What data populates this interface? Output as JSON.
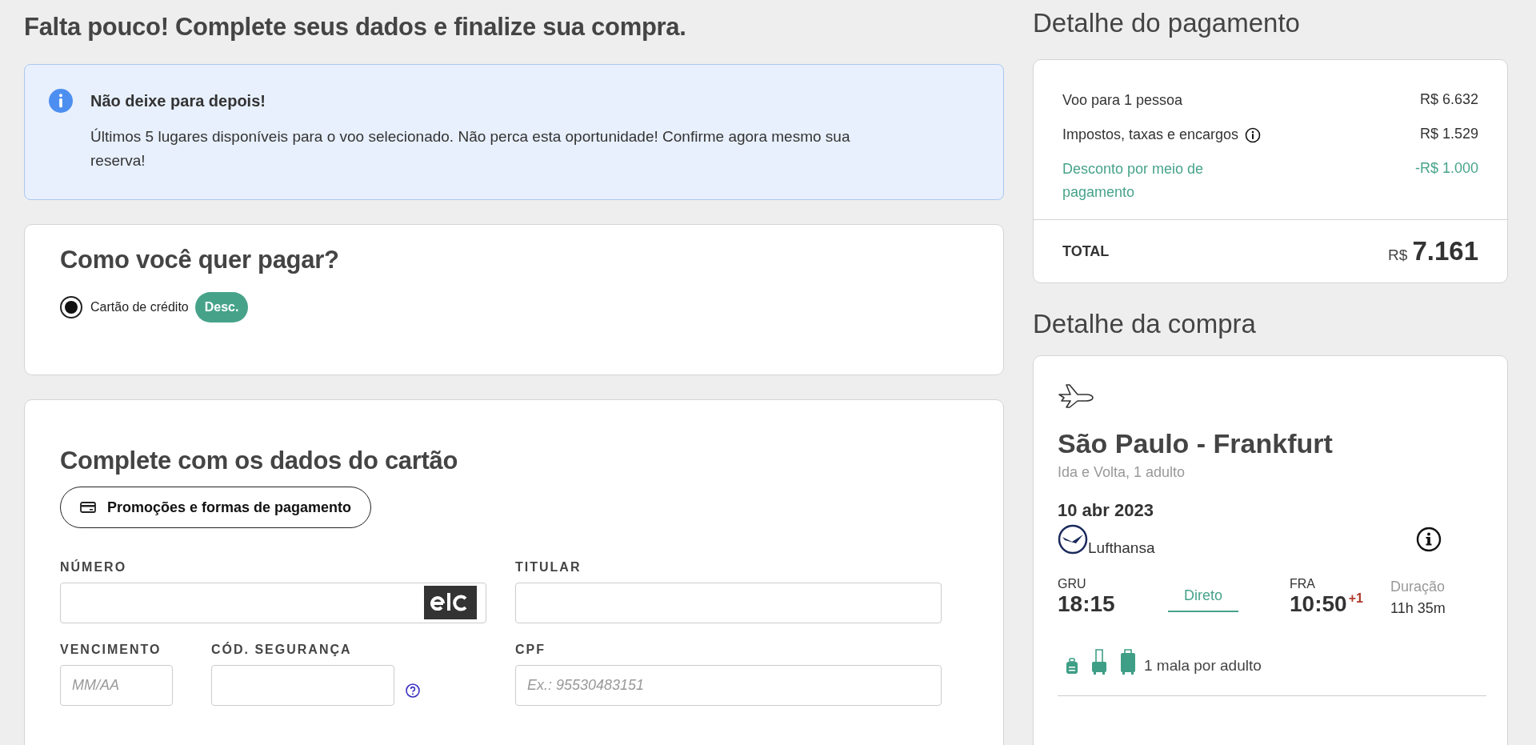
{
  "page_title": "Falta pouco! Complete seus dados e finalize sua compra.",
  "alert": {
    "title": "Não deixe para depois!",
    "message": "Últimos 5 lugares disponíveis para o voo selecionado. Não perca esta oportunidade! Confirme agora mesmo sua reserva!"
  },
  "payment_method": {
    "title": "Como você quer pagar?",
    "options": [
      {
        "label": "Cartão de crédito",
        "selected": true,
        "badge": "Desc."
      }
    ]
  },
  "card_form": {
    "title": "Complete com os dados do cartão",
    "promo_button": "Promoções e formas de pagamento",
    "fields": [
      {
        "label": "NÚMERO",
        "kind": "card_number"
      },
      {
        "label": "TITULAR",
        "kind": "text"
      },
      {
        "label": "VENCIMENTO",
        "kind": "text",
        "placeholder": "MM/AA"
      },
      {
        "label": "CÓD. SEGURANÇA",
        "kind": "security_code"
      },
      {
        "label": "CPF",
        "kind": "text",
        "placeholder": "Ex.: 95530483151"
      }
    ]
  },
  "payment_detail": {
    "title": "Detalhe do pagamento",
    "lines": [
      {
        "label": "Voo para 1 pessoa",
        "amount": "R$ 6.632",
        "kind": "charge",
        "info": false
      },
      {
        "label": "Impostos, taxas e encargos",
        "amount": "R$ 1.529",
        "kind": "charge",
        "info": true
      },
      {
        "label": "Desconto por meio de pagamento",
        "amount": "-R$ 1.000",
        "kind": "discount",
        "info": false
      }
    ],
    "total_label": "TOTAL",
    "total_currency": "R$",
    "total_value": "7.161"
  },
  "purchase_detail": {
    "title": "Detalhe da compra",
    "route": "São Paulo - Frankfurt",
    "trip": "Ida e Volta, 1 adulto",
    "date": "10 abr 2023",
    "airline": "Lufthansa",
    "departure": {
      "code": "GRU",
      "time": "18:15"
    },
    "stops": "Direto",
    "arrival": {
      "code": "FRA",
      "time": "10:50",
      "day_offset": "+1"
    },
    "duration_label": "Duração",
    "duration": "11h 35m",
    "baggage": "1 mala por adulto"
  }
}
